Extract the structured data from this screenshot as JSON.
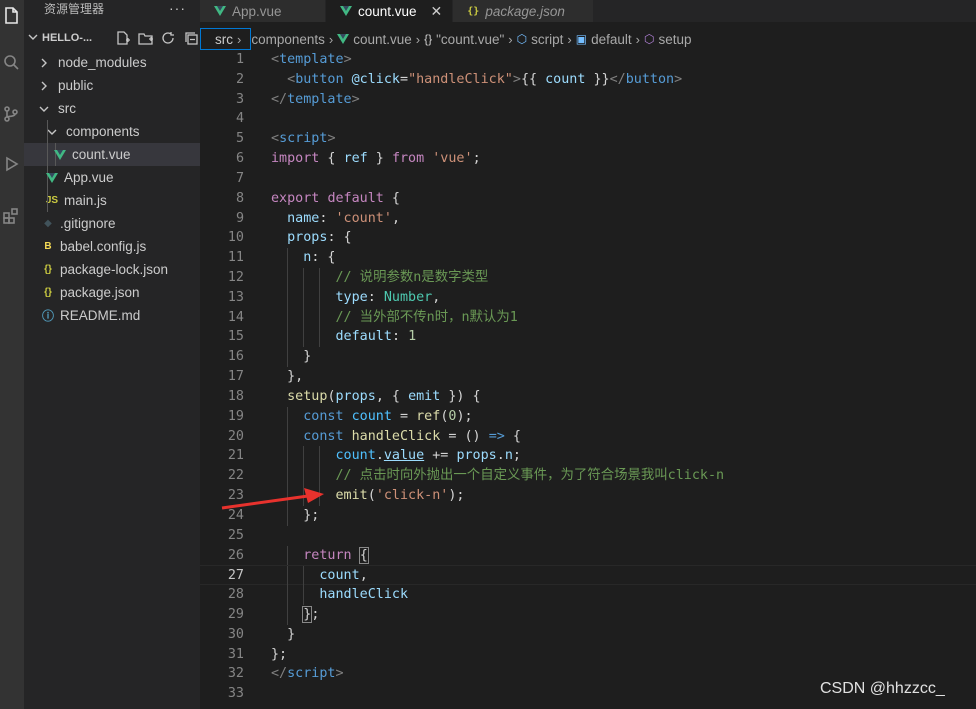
{
  "sidebar": {
    "title": "资源管理器",
    "more": "···",
    "project": "HELLO-...",
    "items": [
      {
        "label": "node_modules",
        "kind": "folder",
        "depth": 0,
        "open": false,
        "icon": "chevron-right-icon"
      },
      {
        "label": "public",
        "kind": "folder",
        "depth": 0,
        "open": false,
        "icon": "chevron-right-icon"
      },
      {
        "label": "src",
        "kind": "folder",
        "depth": 0,
        "open": true,
        "icon": "chevron-down-icon"
      },
      {
        "label": "components",
        "kind": "folder",
        "depth": 1,
        "open": true,
        "icon": "chevron-down-icon"
      },
      {
        "label": "count.vue",
        "kind": "vue",
        "depth": 2,
        "selected": true,
        "icon": "vue-icon"
      },
      {
        "label": "App.vue",
        "kind": "vue",
        "depth": 1,
        "icon": "vue-icon"
      },
      {
        "label": "main.js",
        "kind": "js",
        "depth": 1,
        "icon": "js-icon",
        "icon_text": "JS"
      },
      {
        "label": ".gitignore",
        "kind": "git",
        "depth": 0,
        "icon": "git-icon",
        "icon_text": "◆"
      },
      {
        "label": "babel.config.js",
        "kind": "babel",
        "depth": 0,
        "icon": "babel-icon",
        "icon_text": "B"
      },
      {
        "label": "package-lock.json",
        "kind": "json",
        "depth": 0,
        "icon": "json-icon",
        "icon_text": "{}"
      },
      {
        "label": "package.json",
        "kind": "json",
        "depth": 0,
        "icon": "json-icon",
        "icon_text": "{}"
      },
      {
        "label": "README.md",
        "kind": "info",
        "depth": 0,
        "icon": "info-icon",
        "icon_text": "ⓘ"
      }
    ]
  },
  "tabs": [
    {
      "label": "App.vue",
      "icon": "vue-icon",
      "active": false,
      "italic": false
    },
    {
      "label": "count.vue",
      "icon": "vue-icon",
      "active": true,
      "italic": false,
      "close": "✕"
    },
    {
      "label": "package.json",
      "icon": "json-icon",
      "icon_text": "{}",
      "active": false,
      "italic": true
    }
  ],
  "breadcrumb": {
    "first": "src",
    "items": [
      {
        "label": "components",
        "icon": ""
      },
      {
        "label": "count.vue",
        "icon": "vue-icon"
      },
      {
        "label": "\"count.vue\"",
        "icon": "braces-icon",
        "icon_text": "{}"
      },
      {
        "label": "script",
        "icon": "cube-icon"
      },
      {
        "label": "default",
        "icon": "field-icon"
      },
      {
        "label": "setup",
        "icon": "method-icon"
      }
    ]
  },
  "editor": {
    "current_line": 27,
    "lines": [
      {
        "n": 1,
        "tokens": [
          [
            "t-punct",
            "<"
          ],
          [
            "t-tag",
            "template"
          ],
          [
            "t-punct",
            ">"
          ]
        ]
      },
      {
        "n": 2,
        "tokens": [
          [
            "t-plain",
            "  "
          ],
          [
            "t-punct",
            "<"
          ],
          [
            "t-tag",
            "button"
          ],
          [
            "t-plain",
            " "
          ],
          [
            "t-attr",
            "@click"
          ],
          [
            "t-plain",
            "="
          ],
          [
            "t-str",
            "\"handleClick\""
          ],
          [
            "t-punct",
            ">"
          ],
          [
            "t-plain",
            "{{ "
          ],
          [
            "t-var",
            "count"
          ],
          [
            "t-plain",
            " }}"
          ],
          [
            "t-punct",
            "</"
          ],
          [
            "t-tag",
            "button"
          ],
          [
            "t-punct",
            ">"
          ]
        ]
      },
      {
        "n": 3,
        "tokens": [
          [
            "t-punct",
            "</"
          ],
          [
            "t-tag",
            "template"
          ],
          [
            "t-punct",
            ">"
          ]
        ]
      },
      {
        "n": 4,
        "tokens": []
      },
      {
        "n": 5,
        "tokens": [
          [
            "t-punct",
            "<"
          ],
          [
            "t-tag",
            "script"
          ],
          [
            "t-punct",
            ">"
          ]
        ]
      },
      {
        "n": 6,
        "tokens": [
          [
            "t-ctrl",
            "import"
          ],
          [
            "t-plain",
            " { "
          ],
          [
            "t-var",
            "ref"
          ],
          [
            "t-plain",
            " } "
          ],
          [
            "t-ctrl",
            "from"
          ],
          [
            "t-plain",
            " "
          ],
          [
            "t-str",
            "'vue'"
          ],
          [
            "t-plain",
            ";"
          ]
        ]
      },
      {
        "n": 7,
        "tokens": []
      },
      {
        "n": 8,
        "tokens": [
          [
            "t-ctrl",
            "export"
          ],
          [
            "t-plain",
            " "
          ],
          [
            "t-ctrl",
            "default"
          ],
          [
            "t-plain",
            " {"
          ]
        ]
      },
      {
        "n": 9,
        "tokens": [
          [
            "t-plain",
            "  "
          ],
          [
            "t-var",
            "name"
          ],
          [
            "t-plain",
            ": "
          ],
          [
            "t-str",
            "'count'"
          ],
          [
            "t-plain",
            ","
          ]
        ]
      },
      {
        "n": 10,
        "tokens": [
          [
            "t-plain",
            "  "
          ],
          [
            "t-var",
            "props"
          ],
          [
            "t-plain",
            ": {"
          ]
        ]
      },
      {
        "n": 11,
        "tokens": [
          [
            "t-plain",
            "    "
          ],
          [
            "t-var",
            "n"
          ],
          [
            "t-plain",
            ": {"
          ]
        ]
      },
      {
        "n": 12,
        "tokens": [
          [
            "t-plain",
            "        "
          ],
          [
            "t-cmt",
            "// 说明参数n是数字类型"
          ]
        ]
      },
      {
        "n": 13,
        "tokens": [
          [
            "t-plain",
            "        "
          ],
          [
            "t-var",
            "type"
          ],
          [
            "t-plain",
            ": "
          ],
          [
            "t-type",
            "Number"
          ],
          [
            "t-plain",
            ","
          ]
        ]
      },
      {
        "n": 14,
        "tokens": [
          [
            "t-plain",
            "        "
          ],
          [
            "t-cmt",
            "// 当外部不传n时，n默认为1"
          ]
        ]
      },
      {
        "n": 15,
        "tokens": [
          [
            "t-plain",
            "        "
          ],
          [
            "t-var",
            "default"
          ],
          [
            "t-plain",
            ": "
          ],
          [
            "t-num",
            "1"
          ]
        ]
      },
      {
        "n": 16,
        "tokens": [
          [
            "t-plain",
            "    }"
          ]
        ]
      },
      {
        "n": 17,
        "tokens": [
          [
            "t-plain",
            "  },"
          ]
        ]
      },
      {
        "n": 18,
        "tokens": [
          [
            "t-plain",
            "  "
          ],
          [
            "t-fn",
            "setup"
          ],
          [
            "t-plain",
            "("
          ],
          [
            "t-var",
            "props"
          ],
          [
            "t-plain",
            ", { "
          ],
          [
            "t-var",
            "emit"
          ],
          [
            "t-plain",
            " }) {"
          ]
        ]
      },
      {
        "n": 19,
        "tokens": [
          [
            "t-plain",
            "    "
          ],
          [
            "t-kw",
            "const"
          ],
          [
            "t-plain",
            " "
          ],
          [
            "t-const",
            "count"
          ],
          [
            "t-plain",
            " = "
          ],
          [
            "t-fn",
            "ref"
          ],
          [
            "t-plain",
            "("
          ],
          [
            "t-num",
            "0"
          ],
          [
            "t-plain",
            ");"
          ]
        ]
      },
      {
        "n": 20,
        "tokens": [
          [
            "t-plain",
            "    "
          ],
          [
            "t-kw",
            "const"
          ],
          [
            "t-plain",
            " "
          ],
          [
            "t-fn",
            "handleClick"
          ],
          [
            "t-plain",
            " = () "
          ],
          [
            "t-kw",
            "=>"
          ],
          [
            "t-plain",
            " {"
          ]
        ]
      },
      {
        "n": 21,
        "tokens": [
          [
            "t-plain",
            "        "
          ],
          [
            "t-const",
            "count"
          ],
          [
            "t-plain",
            "."
          ],
          [
            "t-var t-ul",
            "value"
          ],
          [
            "t-plain",
            " += "
          ],
          [
            "t-var",
            "props"
          ],
          [
            "t-plain",
            "."
          ],
          [
            "t-var",
            "n"
          ],
          [
            "t-plain",
            ";"
          ]
        ]
      },
      {
        "n": 22,
        "tokens": [
          [
            "t-plain",
            "        "
          ],
          [
            "t-cmt",
            "// 点击时向外抛出一个自定义事件，为了符合场景我叫click-n"
          ]
        ]
      },
      {
        "n": 23,
        "tokens": [
          [
            "t-plain",
            "        "
          ],
          [
            "t-fn",
            "emit"
          ],
          [
            "t-plain",
            "("
          ],
          [
            "t-str",
            "'click-n'"
          ],
          [
            "t-plain",
            ");"
          ]
        ]
      },
      {
        "n": 24,
        "tokens": [
          [
            "t-plain",
            "    };"
          ]
        ]
      },
      {
        "n": 25,
        "tokens": []
      },
      {
        "n": 26,
        "tokens": [
          [
            "t-plain",
            "    "
          ],
          [
            "t-ctrl",
            "return"
          ],
          [
            "t-plain",
            " "
          ],
          [
            "t-brkt",
            "{"
          ]
        ]
      },
      {
        "n": 27,
        "tokens": [
          [
            "t-plain",
            "      "
          ],
          [
            "t-var",
            "count"
          ],
          [
            "t-plain",
            ","
          ]
        ]
      },
      {
        "n": 28,
        "tokens": [
          [
            "t-plain",
            "      "
          ],
          [
            "t-var",
            "handleClick"
          ]
        ]
      },
      {
        "n": 29,
        "tokens": [
          [
            "t-plain",
            "    "
          ],
          [
            "t-brkt",
            "}"
          ],
          [
            "t-plain",
            ";"
          ]
        ]
      },
      {
        "n": 30,
        "tokens": [
          [
            "t-plain",
            "  }"
          ]
        ]
      },
      {
        "n": 31,
        "tokens": [
          [
            "t-plain",
            "};"
          ]
        ]
      },
      {
        "n": 32,
        "tokens": [
          [
            "t-punct",
            "</"
          ],
          [
            "t-tag",
            "script"
          ],
          [
            "t-punct",
            ">"
          ]
        ]
      },
      {
        "n": 33,
        "tokens": []
      }
    ]
  },
  "annotation": {
    "arrow_color": "#e8322d"
  },
  "watermark": "CSDN @hhzzcc_",
  "colors": {
    "accent": "#0078d4",
    "vue_green": "#41b883",
    "js_yellow": "#cbcb41"
  }
}
